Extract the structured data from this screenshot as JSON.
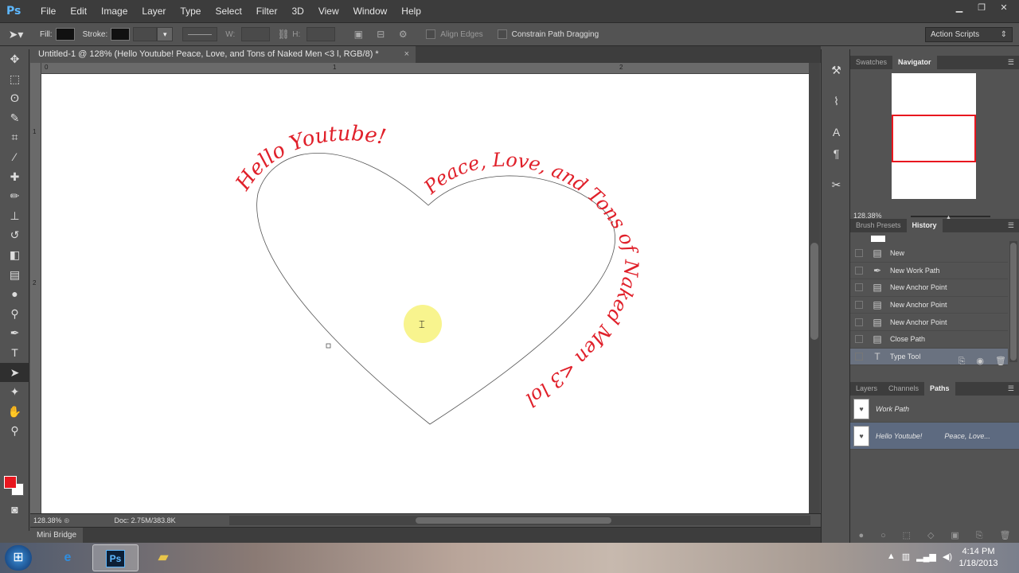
{
  "app": {
    "logo": "Ps"
  },
  "menu": [
    "File",
    "Edit",
    "Image",
    "Layer",
    "Type",
    "Select",
    "Filter",
    "3D",
    "View",
    "Window",
    "Help"
  ],
  "options_bar": {
    "fill_label": "Fill:",
    "stroke_label": "Stroke:",
    "w_label": "W:",
    "h_label": "H:",
    "align_edges": "Align Edges",
    "constrain": "Constrain Path Dragging",
    "workspace": "Action Scripts"
  },
  "document": {
    "tab_title": "Untitled-1 @ 128% (Hello Youtube!       Peace, Love, and Tons of Naked Men <3 l, RGB/8) *",
    "zoom": "128.38%",
    "doc_info": "Doc: 2.75M/383.8K",
    "ruler_top": [
      "0",
      "1",
      "2"
    ],
    "ruler_left": [
      "1",
      "2"
    ]
  },
  "canvas": {
    "text_left": "Hello Youtube!",
    "text_right": "Peace, Love, and Tons of Naked Men <3 lol",
    "text_color": "#e0202a"
  },
  "mini_bridge": "Mini Bridge",
  "navigator": {
    "tabs": [
      "Swatches",
      "Navigator"
    ],
    "active_tab": "Navigator",
    "zoom": "128.38%"
  },
  "history": {
    "tabs": [
      "Brush Presets",
      "History"
    ],
    "active_tab": "History",
    "items": [
      {
        "label": "New",
        "icon": "doc-icon"
      },
      {
        "label": "New Work Path",
        "icon": "pen-icon"
      },
      {
        "label": "New Anchor Point",
        "icon": "doc-icon"
      },
      {
        "label": "New Anchor Point",
        "icon": "doc-icon"
      },
      {
        "label": "New Anchor Point",
        "icon": "doc-icon"
      },
      {
        "label": "Close Path",
        "icon": "doc-icon"
      },
      {
        "label": "Type Tool",
        "icon": "type-icon"
      }
    ]
  },
  "paths": {
    "tabs": [
      "Layers",
      "Channels",
      "Paths"
    ],
    "active_tab": "Paths",
    "items": [
      {
        "label": "Work Path",
        "extra": ""
      },
      {
        "label": "Hello Youtube!",
        "extra": "Peace, Love..."
      }
    ]
  },
  "taskbar": {
    "time": "4:14 PM",
    "date": "1/18/2013"
  },
  "colors": {
    "foreground": "#e8171f",
    "background": "#ffffff",
    "selection": "#5d6a80"
  }
}
